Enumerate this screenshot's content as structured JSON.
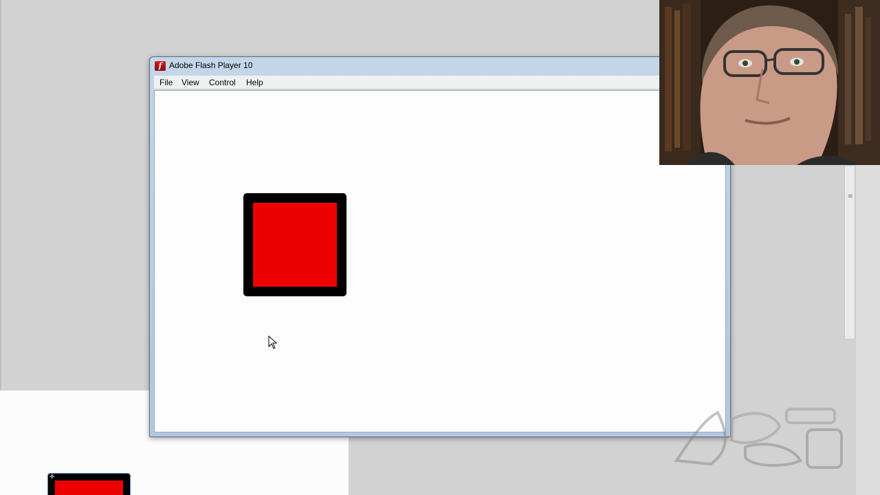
{
  "window": {
    "title": "Adobe Flash Player 10",
    "icon": "flash-player-icon"
  },
  "menu": {
    "items": [
      {
        "label": "File"
      },
      {
        "label": "View"
      },
      {
        "label": "Control"
      },
      {
        "label": "Help"
      }
    ]
  },
  "stage": {
    "shape": "red-square-black-border",
    "fill_color": "#ef0000",
    "stroke_color": "#000000"
  },
  "colors": {
    "desktop": "#d2d2d2",
    "titlebar": "#c4d6ea"
  },
  "webcam": {
    "description_icon": "webcam-overlay"
  }
}
